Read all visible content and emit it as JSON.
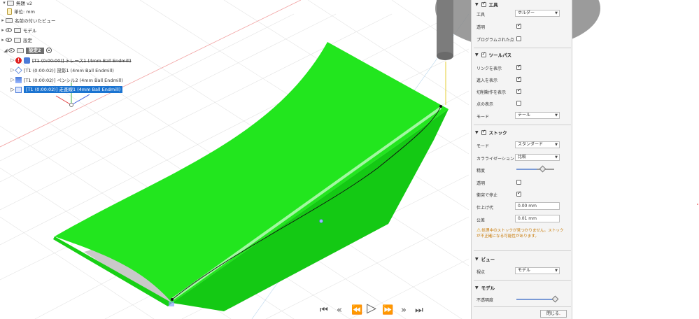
{
  "browser": {
    "rows": [
      {
        "label": "無題 v2"
      },
      {
        "label": "単位: mm"
      },
      {
        "label": "名前の付いたビュー"
      },
      {
        "label": "モデル"
      },
      {
        "label": "設定"
      }
    ],
    "setup": {
      "label": "設定2"
    },
    "operations": [
      {
        "label": "[T1 (0:00:00)] トレース1 (4mm Ball Endmill)",
        "status": "error"
      },
      {
        "label": "[T1 (0:00:02)] 投影1 (4mm Ball Endmill)",
        "status": "ok"
      },
      {
        "label": "[T1 (0:00:02)] ペンシル2 (4mm Ball Endmill)",
        "status": "ok"
      },
      {
        "label": "[T1 (0:00:02)] 走査線1 (4mm Ball Endmill)",
        "status": "selected"
      }
    ]
  },
  "playback": {
    "buttons": [
      "⏮",
      "«",
      "⏪",
      "▷",
      "⏩",
      "»",
      "⏭"
    ]
  },
  "panel": {
    "tool_section": {
      "title": "工具",
      "tool_label": "工具",
      "tool_value": "ホルダー",
      "transparent_label": "透明",
      "programmed_point_label": "プログラムされた点"
    },
    "toolpath_section": {
      "title": "ツールパス",
      "show_links_label": "リンクを表示",
      "show_leads_label": "進入を表示",
      "show_cutting_label": "切削動作を表示",
      "show_points_label": "点の表示",
      "mode_label": "モード",
      "mode_value": "テール"
    },
    "stock_section": {
      "title": "ストック",
      "mode_label": "モード",
      "mode_value": "スタンダード",
      "colorization_label": "カラライゼーション",
      "colorization_value": "比較",
      "accuracy_label": "精度",
      "accuracy_fraction": 0.55,
      "transparent_label": "透明",
      "stop_on_collision_label": "衝突で停止",
      "finish_allowance_label": "仕上げ代",
      "finish_allowance_value": "0.00 mm",
      "tolerance_label": "公差",
      "tolerance_value": "0.01 mm",
      "warning_text": "処理中のストックが見つかりません。ストックが不正確になる可能性があります。"
    },
    "view_section": {
      "title": "ビュー",
      "viewpoint_label": "視点",
      "viewpoint_value": "モデル"
    },
    "model_section": {
      "title": "モデル",
      "opacity_label": "不透明度",
      "opacity_fraction": 0.95
    },
    "close_label": "閉じる"
  },
  "colors": {
    "model_green": "#22e61e",
    "selection_blue": "#1b74d1",
    "error_red": "#e02020",
    "warning_orange": "#c77700"
  }
}
